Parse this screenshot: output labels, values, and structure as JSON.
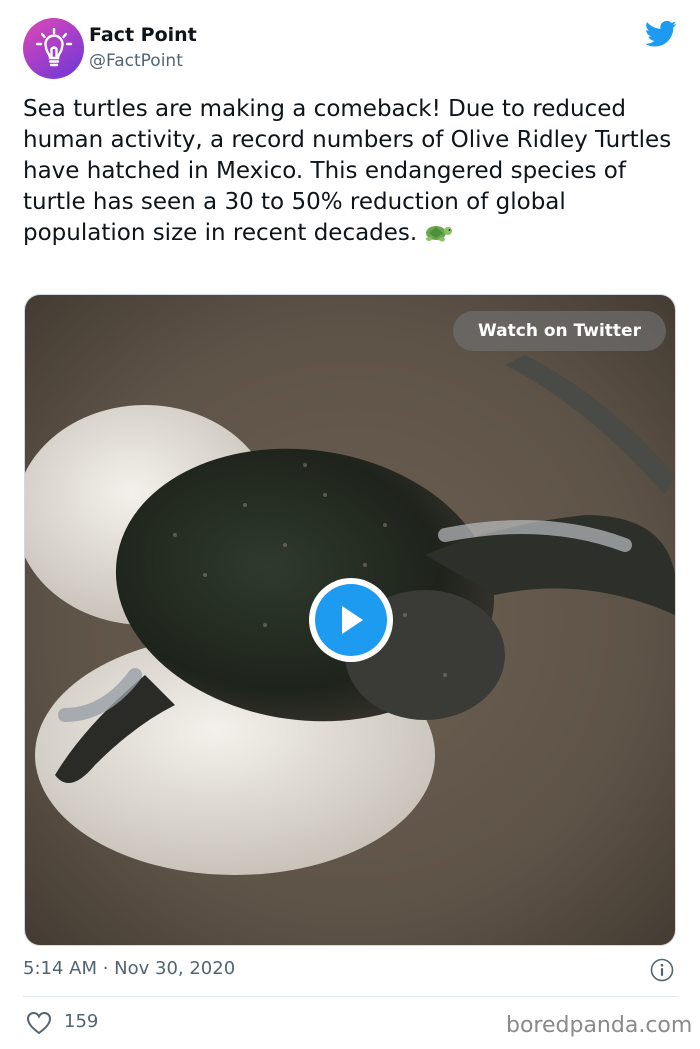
{
  "author": {
    "display_name": "Fact Point",
    "handle": "@FactPoint",
    "avatar_icon": "lightbulb-icon",
    "avatar_colors": [
      "#e048b4",
      "#6a37d6"
    ]
  },
  "platform_icon": "twitter-bird-icon",
  "tweet": {
    "text": "Sea turtles are making a comeback! Due to reduced human activity, a record numbers of Olive Ridley Turtles have hatched in Mexico. This endangered species of turtle has seen a 30 to 50% reduction of global population size in recent decades.",
    "emoji": "turtle-icon"
  },
  "media": {
    "watch_label": "Watch on Twitter",
    "play_icon": "play-icon"
  },
  "meta": {
    "timestamp": "5:14 AM · Nov 30, 2020",
    "info_icon": "info-icon"
  },
  "engagement": {
    "likes": "159",
    "like_icon": "heart-icon"
  },
  "watermark": "boredpanda.com",
  "colors": {
    "twitter_blue": "#1d9bf0",
    "text_primary": "#0f1419",
    "text_secondary": "#536471"
  }
}
